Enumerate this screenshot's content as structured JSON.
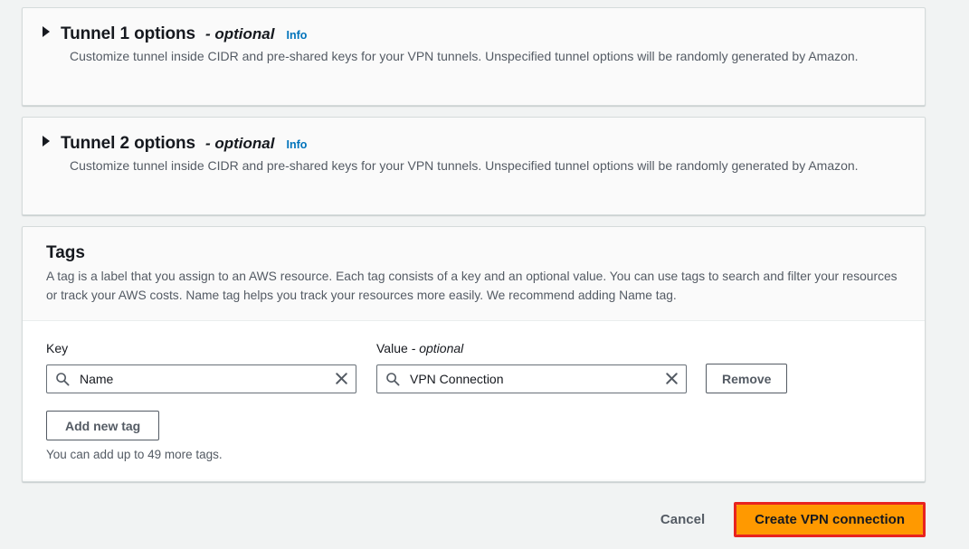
{
  "sections": [
    {
      "title": "Tunnel 1 options",
      "optional_label": "- optional",
      "info_label": "Info",
      "description": "Customize tunnel inside CIDR and pre-shared keys for your VPN tunnels. Unspecified tunnel options will be randomly generated by Amazon."
    },
    {
      "title": "Tunnel 2 options",
      "optional_label": "- optional",
      "info_label": "Info",
      "description": "Customize tunnel inside CIDR and pre-shared keys for your VPN tunnels. Unspecified tunnel options will be randomly generated by Amazon."
    }
  ],
  "tags": {
    "title": "Tags",
    "description": "A tag is a label that you assign to an AWS resource. Each tag consists of a key and an optional value. You can use tags to search and filter your resources or track your AWS costs. Name tag helps you track your resources more easily. We recommend adding Name tag.",
    "key_label": "Key",
    "value_label": "Value ",
    "value_label_optional": "- optional",
    "rows": [
      {
        "key_value": "Name",
        "key_placeholder": "",
        "value_value": "VPN Connection",
        "value_placeholder": "",
        "remove_label": "Remove"
      }
    ],
    "add_tag_label": "Add new tag",
    "limit_note": "You can add up to 49 more tags."
  },
  "footer": {
    "cancel_label": "Cancel",
    "submit_label": "Create VPN connection"
  },
  "colors": {
    "primary": "#ff9900",
    "highlight": "#e8231f",
    "link": "#0073bb",
    "page_bg": "#f1f3f3",
    "card_bg": "#fafafa"
  },
  "icons": {
    "search": "search-icon",
    "clear": "close-icon",
    "caret": "caret-right-icon"
  }
}
